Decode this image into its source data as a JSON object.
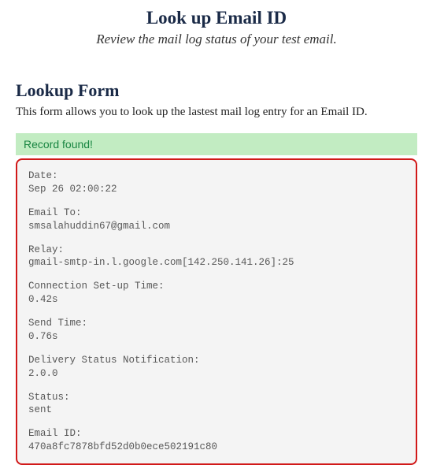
{
  "header": {
    "title": "Look up Email ID",
    "subtitle": "Review the mail log status of your test email."
  },
  "form": {
    "title": "Lookup Form",
    "description": "This form allows you to look up the lastest mail log entry for an Email ID."
  },
  "status": {
    "message": "Record found!"
  },
  "result": {
    "fields": [
      {
        "label": "Date:",
        "value": "Sep 26 02:00:22"
      },
      {
        "label": "Email To:",
        "value": "smsalahuddin67@gmail.com"
      },
      {
        "label": "Relay:",
        "value": "gmail-smtp-in.l.google.com[142.250.141.26]:25"
      },
      {
        "label": "Connection Set-up Time:",
        "value": "0.42s"
      },
      {
        "label": "Send Time:",
        "value": "0.76s"
      },
      {
        "label": "Delivery Status Notification:",
        "value": "2.0.0"
      },
      {
        "label": "Status:",
        "value": "sent"
      },
      {
        "label": "Email ID:",
        "value": "470a8fc7878bfd52d0b0ece502191c80"
      }
    ]
  }
}
